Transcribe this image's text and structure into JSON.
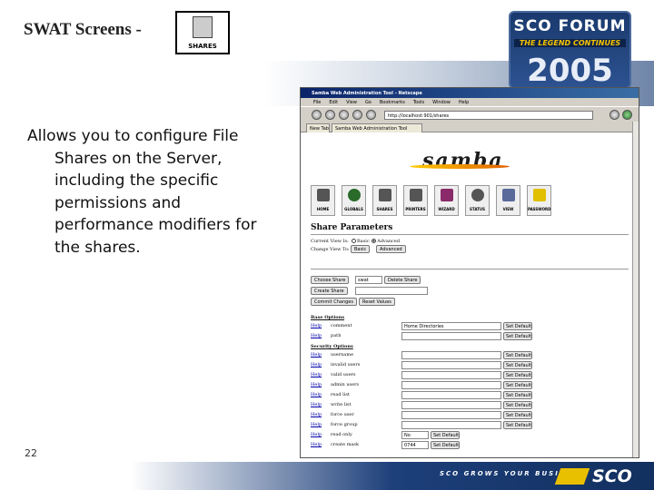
{
  "slide": {
    "title": "SWAT Screens -",
    "shares_icon_label": "SHARES",
    "description": "Allows you to configure File Shares on the Server, including the specific permissions and performance modifiers for the shares.",
    "page_number": "22",
    "footer_tagline": "SCO GROWS YOUR BUSINESS",
    "footer_logo": "SCO"
  },
  "event_logo": {
    "line1": "SCO FORUM",
    "line2": "THE LEGEND CONTINUES",
    "line3": "2005"
  },
  "browser": {
    "window_title": "Samba Web Administration Tool - Netscape",
    "menus": [
      "File",
      "Edit",
      "View",
      "Go",
      "Bookmarks",
      "Tools",
      "Window",
      "Help"
    ],
    "url": "http://localhost:901/shares",
    "tabs": [
      "New Tab",
      "Samba Web Administration Tool"
    ]
  },
  "swat": {
    "logo_text": "samba",
    "nav": [
      "HOME",
      "GLOBALS",
      "SHARES",
      "PRINTERS",
      "WIZARD",
      "STATUS",
      "VIEW",
      "PASSWORD"
    ],
    "section_title": "Share Parameters",
    "current_view_label": "Current View Is:",
    "view_basic": "Basic",
    "view_advanced": "Advanced",
    "change_view_label": "Change View To:",
    "change_basic": "Basic",
    "change_advanced": "Advanced",
    "choose_share_button": "Choose Share",
    "share_selected": "swat",
    "delete_share_button": "Delete Share",
    "create_share_button": "Create Share",
    "commit_button": "Commit Changes",
    "reset_button": "Reset Values",
    "base_options_label": "Base Options",
    "security_options_label": "Security Options",
    "help_label": "Help",
    "set_default_label": "Set Default",
    "base_rows": [
      {
        "name": "comment",
        "value": "Home Directories"
      },
      {
        "name": "path",
        "value": ""
      }
    ],
    "security_rows": [
      {
        "name": "username",
        "value": ""
      },
      {
        "name": "invalid users",
        "value": ""
      },
      {
        "name": "valid users",
        "value": ""
      },
      {
        "name": "admin users",
        "value": ""
      },
      {
        "name": "read list",
        "value": ""
      },
      {
        "name": "write list",
        "value": ""
      },
      {
        "name": "force user",
        "value": ""
      },
      {
        "name": "force group",
        "value": ""
      },
      {
        "name": "read only",
        "value": "No"
      },
      {
        "name": "create mask",
        "value": "0744"
      }
    ]
  }
}
